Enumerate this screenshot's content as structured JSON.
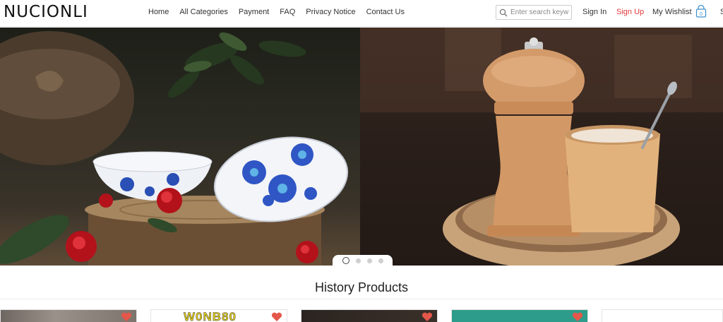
{
  "header": {
    "logo": "NUCIONLI",
    "nav": [
      "Home",
      "All Categories",
      "Payment",
      "FAQ",
      "Privacy Notice",
      "Contact Us"
    ],
    "search": {
      "placeholder": "Enter search keyw",
      "icon": "search-icon"
    },
    "sign_in": "Sign In",
    "sign_up": "Sign Up",
    "wishlist": "My Wishlist",
    "bag_count": "0",
    "edge_char": "S",
    "accent_color": "#e4393c"
  },
  "banner": {
    "slide_count": 4,
    "active_slide": 0
  },
  "section": {
    "title": "History Products"
  },
  "products": [
    {
      "text": ""
    },
    {
      "text": "W0NB80"
    },
    {
      "text": ""
    },
    {
      "text": ""
    },
    {
      "text": ""
    }
  ]
}
